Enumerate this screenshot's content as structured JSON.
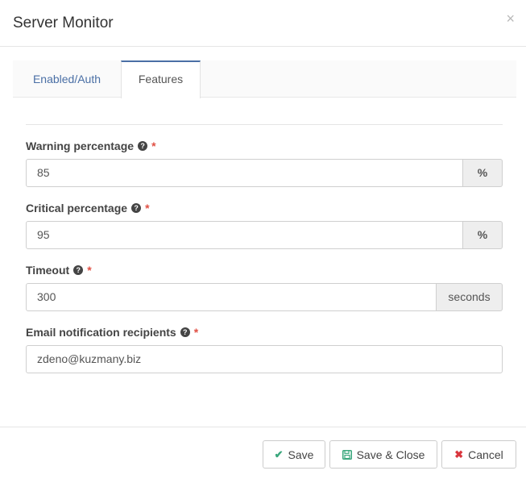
{
  "header": {
    "title": "Server Monitor",
    "close_glyph": "×"
  },
  "tabs": [
    {
      "label": "Enabled/Auth",
      "active": false
    },
    {
      "label": "Features",
      "active": true
    }
  ],
  "fields": {
    "warning": {
      "label": "Warning percentage",
      "value": "85",
      "addon": "%",
      "required": "*"
    },
    "critical": {
      "label": "Critical percentage",
      "value": "95",
      "addon": "%",
      "required": "*"
    },
    "timeout": {
      "label": "Timeout",
      "value": "300",
      "addon": "seconds",
      "required": "*"
    },
    "email": {
      "label": "Email notification recipients",
      "value": "zdeno@kuzmany.biz",
      "required": "*"
    }
  },
  "footer": {
    "save_label": "Save",
    "save_close_label": "Save & Close",
    "cancel_label": "Cancel"
  },
  "icons": {
    "help": "question-circle-icon",
    "save": "check-icon",
    "save_close": "floppy-disk-icon",
    "cancel": "x-icon"
  },
  "colors": {
    "accent": "#4a6fa5",
    "required": "#e04f43",
    "success": "#3aa77d",
    "danger": "#d9363e"
  }
}
